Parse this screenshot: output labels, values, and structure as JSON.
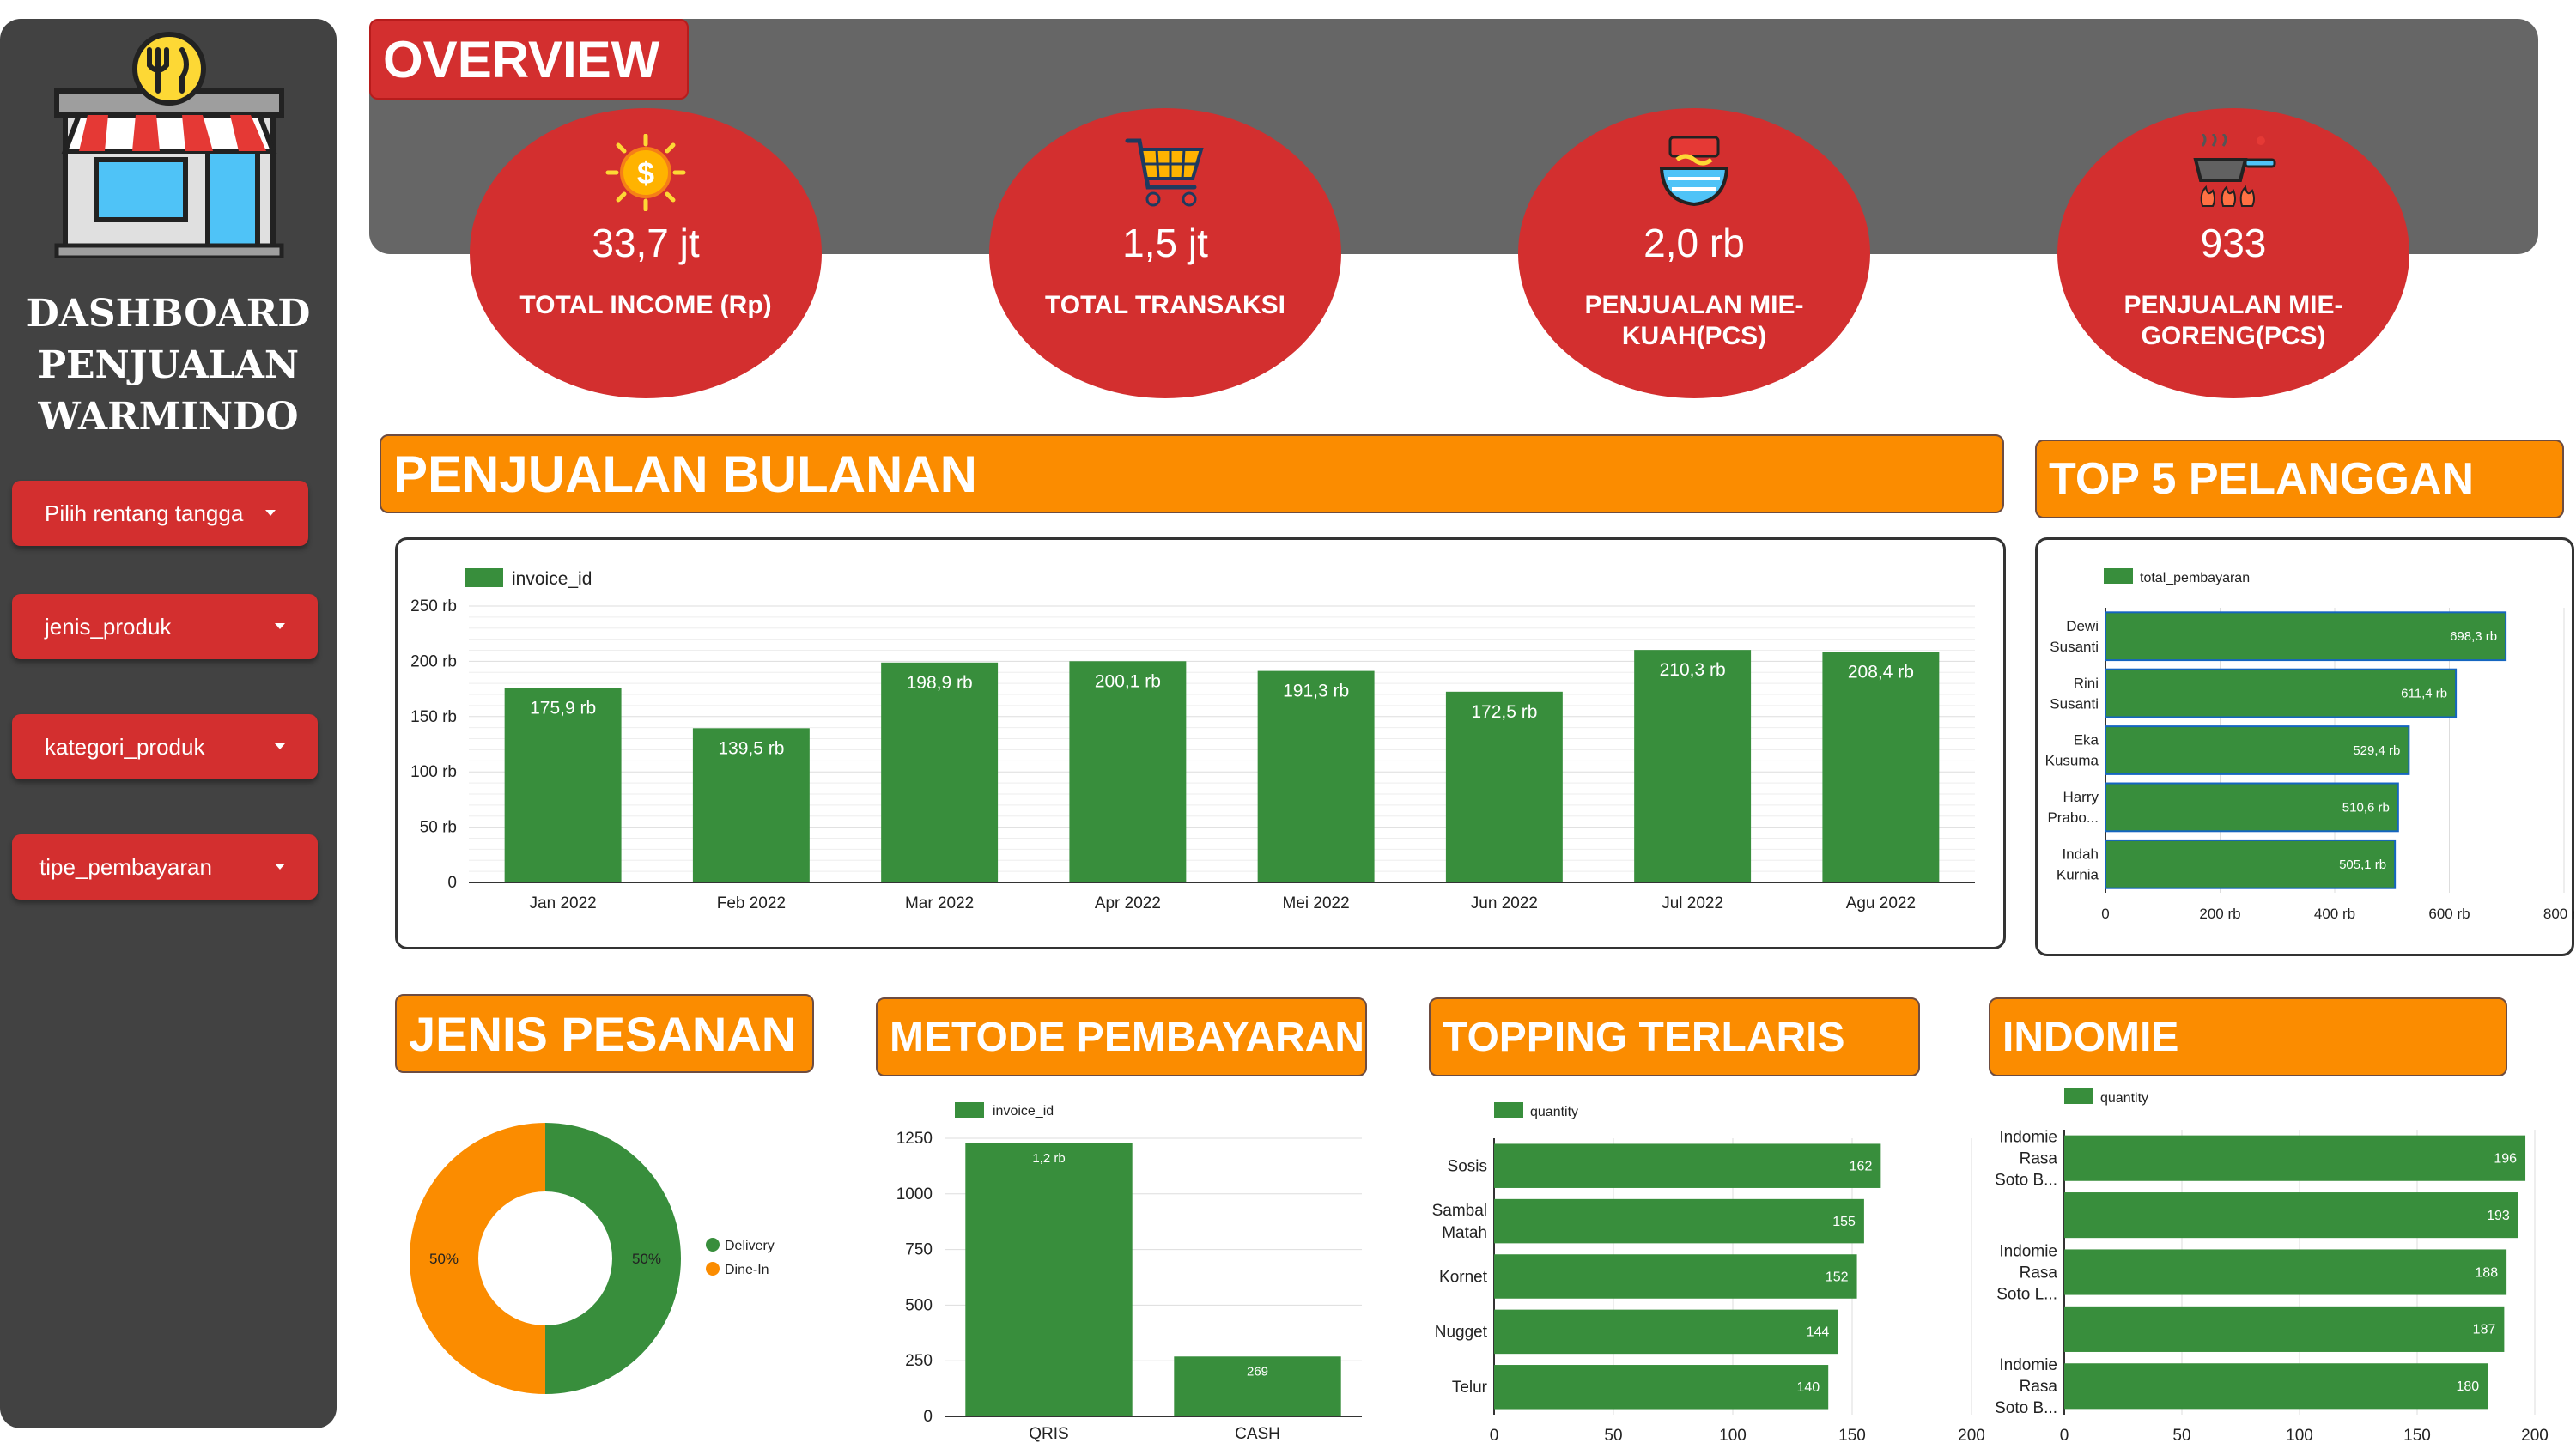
{
  "sidebar": {
    "title_lines": [
      "DASHBOARD",
      "PENJUALAN",
      "WARMINDO"
    ],
    "filters": [
      "Pilih rentang tangga",
      "jenis_produk",
      "kategori_produk",
      "tipe_pembayaran"
    ]
  },
  "overview": {
    "title": "OVERVIEW",
    "kpis": [
      {
        "value": "33,7 jt",
        "label": "TOTAL INCOME (Rp)",
        "icon": "coin-icon"
      },
      {
        "value": "1,5 jt",
        "label": "TOTAL TRANSAKSI",
        "icon": "cart-icon"
      },
      {
        "value": "2,0 rb",
        "label": "PENJUALAN MIE-KUAH(PCS)",
        "icon": "noodle-bowl-icon"
      },
      {
        "value": "933",
        "label": "PENJUALAN MIE-GORENG(PCS)",
        "icon": "frying-pan-icon"
      }
    ]
  },
  "sections": {
    "monthly": "PENJUALAN BULANAN",
    "top5": "TOP 5 PELANGGAN",
    "order_type": "JENIS PESANAN",
    "payment": "METODE PEMBAYARAN",
    "topping": "TOPPING TERLARIS",
    "indomie": "INDOMIE"
  },
  "colors": {
    "red": "#d32f2f",
    "orange": "#fb8c00",
    "green": "#388e3c",
    "sidebar": "#424242",
    "band": "#666666"
  },
  "chart_data": [
    {
      "id": "monthly",
      "type": "bar",
      "legend": "invoice_id",
      "categories": [
        "Jan 2022",
        "Feb 2022",
        "Mar 2022",
        "Apr 2022",
        "Mei 2022",
        "Jun 2022",
        "Jul 2022",
        "Agu 2022"
      ],
      "values": [
        175900,
        139500,
        198900,
        200100,
        191300,
        172500,
        210300,
        208400
      ],
      "labels": [
        "175,9 rb",
        "139,5 rb",
        "198,9 rb",
        "200,1 rb",
        "191,3 rb",
        "172,5 rb",
        "210,3 rb",
        "208,4 rb"
      ],
      "ylim": [
        0,
        250000
      ],
      "yticks": [
        "0",
        "50 rb",
        "100 rb",
        "150 rb",
        "200 rb",
        "250 rb"
      ]
    },
    {
      "id": "top5",
      "type": "bar",
      "orientation": "horizontal",
      "legend": "total_pembayaran",
      "categories": [
        [
          "Dewi",
          "Susanti"
        ],
        [
          "Rini",
          "Susanti"
        ],
        [
          "Eka",
          "Kusuma"
        ],
        [
          "Harry",
          "Prabo..."
        ],
        [
          "Indah",
          "Kurnia"
        ]
      ],
      "values": [
        698300,
        611400,
        529400,
        510600,
        505100
      ],
      "labels": [
        "698,3 rb",
        "611,4 rb",
        "529,4 rb",
        "510,6 rb",
        "505,1 rb"
      ],
      "xlim": [
        0,
        800000
      ],
      "xticks": [
        "0",
        "200 rb",
        "400 rb",
        "600 rb",
        "800 rb"
      ]
    },
    {
      "id": "order_type",
      "type": "pie",
      "slices": [
        {
          "name": "Delivery",
          "value": 50,
          "label": "50%",
          "color": "#388e3c"
        },
        {
          "name": "Dine-In",
          "value": 50,
          "label": "50%",
          "color": "#fb8c00"
        }
      ]
    },
    {
      "id": "payment",
      "type": "bar",
      "legend": "invoice_id",
      "categories": [
        "QRIS",
        "CASH"
      ],
      "values": [
        1227,
        269
      ],
      "labels": [
        "1,2 rb",
        "269"
      ],
      "ylim": [
        0,
        1250
      ],
      "yticks": [
        "0",
        "250",
        "500",
        "750",
        "1000",
        "1250"
      ]
    },
    {
      "id": "topping",
      "type": "bar",
      "orientation": "horizontal",
      "legend": "quantity",
      "categories": [
        [
          "Sosis"
        ],
        [
          "Sambal",
          "Matah"
        ],
        [
          "Kornet"
        ],
        [
          "Nugget"
        ],
        [
          "Telur"
        ]
      ],
      "values": [
        162,
        155,
        152,
        144,
        140
      ],
      "labels": [
        "162",
        "155",
        "152",
        "144",
        "140"
      ],
      "xlim": [
        0,
        200
      ],
      "xticks": [
        "0",
        "50",
        "100",
        "150",
        "200"
      ]
    },
    {
      "id": "indomie",
      "type": "bar",
      "orientation": "horizontal",
      "legend": "quantity",
      "categories": [
        [
          "Indomie",
          "Rasa",
          "Soto B..."
        ],
        [],
        [
          "Indomie",
          "Rasa",
          "Soto L..."
        ],
        [],
        [
          "Indomie",
          "Rasa",
          "Soto B..."
        ]
      ],
      "values": [
        196,
        193,
        188,
        187,
        180
      ],
      "labels": [
        "196",
        "193",
        "188",
        "187",
        "180"
      ],
      "xlim": [
        0,
        200
      ],
      "xticks": [
        "0",
        "50",
        "100",
        "150",
        "200"
      ]
    }
  ]
}
